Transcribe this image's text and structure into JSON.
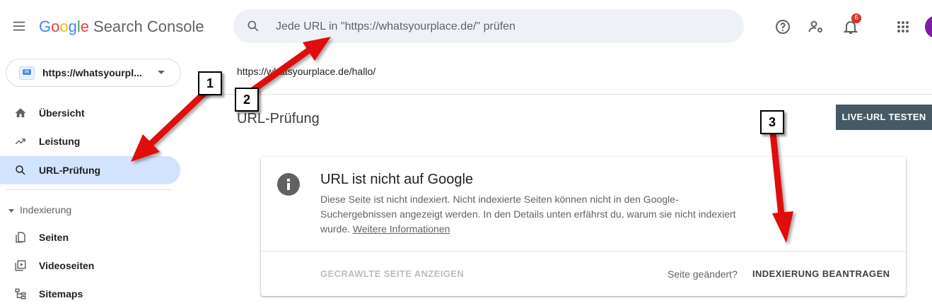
{
  "header": {
    "logo_google": [
      "G",
      "o",
      "o",
      "g",
      "l",
      "e"
    ],
    "product": "Search Console",
    "search_placeholder": "Jede URL in \"https://whatsyourplace.de/\" prüfen",
    "notification_count": "6"
  },
  "sidebar": {
    "property": "https://whatsyourpl...",
    "property_favicon": "de",
    "items": [
      {
        "label": "Übersicht",
        "icon": "home-icon"
      },
      {
        "label": "Leistung",
        "icon": "trending-up-icon"
      },
      {
        "label": "URL-Prüfung",
        "icon": "search-icon",
        "active": true
      }
    ],
    "section": "Indexierung",
    "section_items": [
      {
        "label": "Seiten",
        "icon": "pages-icon"
      },
      {
        "label": "Videoseiten",
        "icon": "video-pages-icon"
      },
      {
        "label": "Sitemaps",
        "icon": "sitemap-icon"
      }
    ]
  },
  "main": {
    "url_path": "https://whatsyourplace.de/hallo/",
    "page_title": "URL-Prüfung",
    "live_button": "LIVE-URL TESTEN",
    "card": {
      "title": "URL ist nicht auf Google",
      "description": "Diese Seite ist nicht indexiert. Nicht indexierte Seiten können nicht in den Google-Suchergebnissen angezeigt werden. In den Details unten erfährst du, warum sie nicht indexiert wurde.",
      "more_link": "Weitere Informationen",
      "crawled_button": "GECRAWLTE SEITE ANZEIGEN",
      "changed_text": "Seite geändert?",
      "request_button": "INDEXIERUNG BEANTRAGEN"
    }
  },
  "annotations": {
    "labels": [
      "1",
      "2",
      "3"
    ],
    "arrow_color": "#e01010"
  },
  "colors": {
    "accent": "#1a73e8",
    "active_nav": "#d2e3fc",
    "live_button_bg": "#455a64",
    "badge": "#d93025"
  }
}
